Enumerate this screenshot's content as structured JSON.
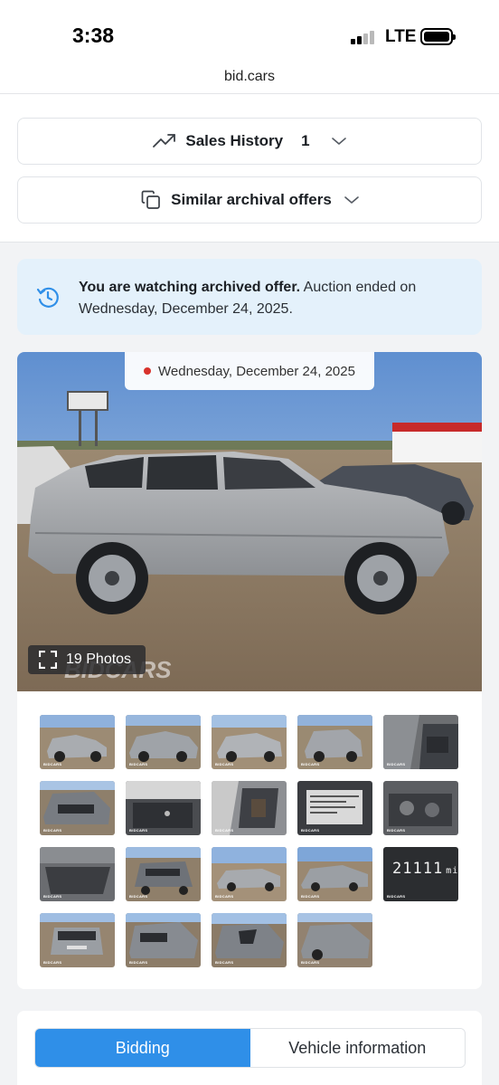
{
  "status_bar": {
    "time": "3:38",
    "network": "LTE",
    "icons": [
      "signal-icon",
      "battery-icon"
    ]
  },
  "browser": {
    "url": "bid.cars"
  },
  "top_panel": {
    "sales_history": {
      "label": "Sales History",
      "count": "1",
      "icon": "trending-up-icon"
    },
    "similar_offers": {
      "label": "Similar archival offers",
      "icon": "copy-icon"
    }
  },
  "notice": {
    "bold": "You are watching archived offer.",
    "text": " Auction ended on Wednesday, December 24, 2025.",
    "icon": "history-icon",
    "background": "#e4f1fb"
  },
  "gallery": {
    "date": "Wednesday, December 24, 2025",
    "photos_label": "19 Photos",
    "watermark": "BIDCARS",
    "thumbnail_watermark": "BIDCARS",
    "odometer": {
      "value": "21111",
      "unit": "mi"
    },
    "thumbnail_count": 19
  },
  "tabs": {
    "items": [
      {
        "label": "Bidding",
        "active": true
      },
      {
        "label": "Vehicle information",
        "active": false
      }
    ],
    "accent": "#2f8fe8"
  }
}
